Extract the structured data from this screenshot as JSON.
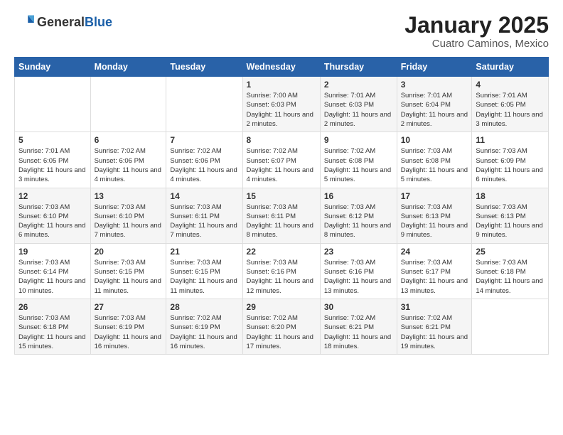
{
  "header": {
    "logo_general": "General",
    "logo_blue": "Blue",
    "month_title": "January 2025",
    "location": "Cuatro Caminos, Mexico"
  },
  "weekdays": [
    "Sunday",
    "Monday",
    "Tuesday",
    "Wednesday",
    "Thursday",
    "Friday",
    "Saturday"
  ],
  "weeks": [
    [
      {
        "day": "",
        "info": ""
      },
      {
        "day": "",
        "info": ""
      },
      {
        "day": "",
        "info": ""
      },
      {
        "day": "1",
        "info": "Sunrise: 7:00 AM\nSunset: 6:03 PM\nDaylight: 11 hours\nand 2 minutes."
      },
      {
        "day": "2",
        "info": "Sunrise: 7:01 AM\nSunset: 6:03 PM\nDaylight: 11 hours\nand 2 minutes."
      },
      {
        "day": "3",
        "info": "Sunrise: 7:01 AM\nSunset: 6:04 PM\nDaylight: 11 hours\nand 2 minutes."
      },
      {
        "day": "4",
        "info": "Sunrise: 7:01 AM\nSunset: 6:05 PM\nDaylight: 11 hours\nand 3 minutes."
      }
    ],
    [
      {
        "day": "5",
        "info": "Sunrise: 7:01 AM\nSunset: 6:05 PM\nDaylight: 11 hours\nand 3 minutes."
      },
      {
        "day": "6",
        "info": "Sunrise: 7:02 AM\nSunset: 6:06 PM\nDaylight: 11 hours\nand 4 minutes."
      },
      {
        "day": "7",
        "info": "Sunrise: 7:02 AM\nSunset: 6:06 PM\nDaylight: 11 hours\nand 4 minutes."
      },
      {
        "day": "8",
        "info": "Sunrise: 7:02 AM\nSunset: 6:07 PM\nDaylight: 11 hours\nand 4 minutes."
      },
      {
        "day": "9",
        "info": "Sunrise: 7:02 AM\nSunset: 6:08 PM\nDaylight: 11 hours\nand 5 minutes."
      },
      {
        "day": "10",
        "info": "Sunrise: 7:03 AM\nSunset: 6:08 PM\nDaylight: 11 hours\nand 5 minutes."
      },
      {
        "day": "11",
        "info": "Sunrise: 7:03 AM\nSunset: 6:09 PM\nDaylight: 11 hours\nand 6 minutes."
      }
    ],
    [
      {
        "day": "12",
        "info": "Sunrise: 7:03 AM\nSunset: 6:10 PM\nDaylight: 11 hours\nand 6 minutes."
      },
      {
        "day": "13",
        "info": "Sunrise: 7:03 AM\nSunset: 6:10 PM\nDaylight: 11 hours\nand 7 minutes."
      },
      {
        "day": "14",
        "info": "Sunrise: 7:03 AM\nSunset: 6:11 PM\nDaylight: 11 hours\nand 7 minutes."
      },
      {
        "day": "15",
        "info": "Sunrise: 7:03 AM\nSunset: 6:11 PM\nDaylight: 11 hours\nand 8 minutes."
      },
      {
        "day": "16",
        "info": "Sunrise: 7:03 AM\nSunset: 6:12 PM\nDaylight: 11 hours\nand 8 minutes."
      },
      {
        "day": "17",
        "info": "Sunrise: 7:03 AM\nSunset: 6:13 PM\nDaylight: 11 hours\nand 9 minutes."
      },
      {
        "day": "18",
        "info": "Sunrise: 7:03 AM\nSunset: 6:13 PM\nDaylight: 11 hours\nand 9 minutes."
      }
    ],
    [
      {
        "day": "19",
        "info": "Sunrise: 7:03 AM\nSunset: 6:14 PM\nDaylight: 11 hours\nand 10 minutes."
      },
      {
        "day": "20",
        "info": "Sunrise: 7:03 AM\nSunset: 6:15 PM\nDaylight: 11 hours\nand 11 minutes."
      },
      {
        "day": "21",
        "info": "Sunrise: 7:03 AM\nSunset: 6:15 PM\nDaylight: 11 hours\nand 11 minutes."
      },
      {
        "day": "22",
        "info": "Sunrise: 7:03 AM\nSunset: 6:16 PM\nDaylight: 11 hours\nand 12 minutes."
      },
      {
        "day": "23",
        "info": "Sunrise: 7:03 AM\nSunset: 6:16 PM\nDaylight: 11 hours\nand 13 minutes."
      },
      {
        "day": "24",
        "info": "Sunrise: 7:03 AM\nSunset: 6:17 PM\nDaylight: 11 hours\nand 13 minutes."
      },
      {
        "day": "25",
        "info": "Sunrise: 7:03 AM\nSunset: 6:18 PM\nDaylight: 11 hours\nand 14 minutes."
      }
    ],
    [
      {
        "day": "26",
        "info": "Sunrise: 7:03 AM\nSunset: 6:18 PM\nDaylight: 11 hours\nand 15 minutes."
      },
      {
        "day": "27",
        "info": "Sunrise: 7:03 AM\nSunset: 6:19 PM\nDaylight: 11 hours\nand 16 minutes."
      },
      {
        "day": "28",
        "info": "Sunrise: 7:02 AM\nSunset: 6:19 PM\nDaylight: 11 hours\nand 16 minutes."
      },
      {
        "day": "29",
        "info": "Sunrise: 7:02 AM\nSunset: 6:20 PM\nDaylight: 11 hours\nand 17 minutes."
      },
      {
        "day": "30",
        "info": "Sunrise: 7:02 AM\nSunset: 6:21 PM\nDaylight: 11 hours\nand 18 minutes."
      },
      {
        "day": "31",
        "info": "Sunrise: 7:02 AM\nSunset: 6:21 PM\nDaylight: 11 hours\nand 19 minutes."
      },
      {
        "day": "",
        "info": ""
      }
    ]
  ]
}
